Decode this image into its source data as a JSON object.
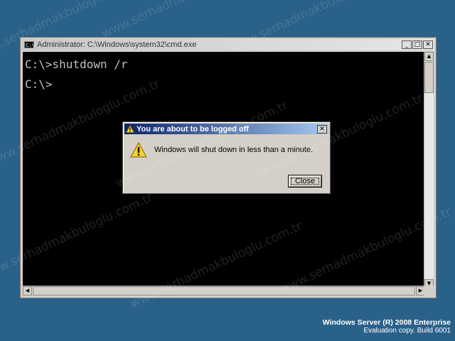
{
  "cmd_window": {
    "title": "Administrator: C:\\Windows\\system32\\cmd.exe",
    "icon_label": "C:\\",
    "buttons": {
      "minimize": "_",
      "maximize": "□",
      "close": "✕"
    },
    "console_lines": [
      "C:\\>shutdown /r",
      "C:\\>"
    ]
  },
  "dialog": {
    "title": "You are about to be logged off",
    "message": "Windows will shut down in less than a minute.",
    "close_button": "Close",
    "close_x": "✕",
    "icon": "warning-icon"
  },
  "watermark": "www.serhadmakbuloglu.com.tr",
  "branding": {
    "line1": "Windows Server (R) 2008 Enterprise",
    "line2": "Evaluation copy. Build 6001"
  },
  "colors": {
    "desktop": "#2a6189",
    "console_bg": "#000000",
    "console_text": "#c0c0c0",
    "dialog_title_start": "#0a246a",
    "dialog_title_end": "#a6caf0"
  }
}
